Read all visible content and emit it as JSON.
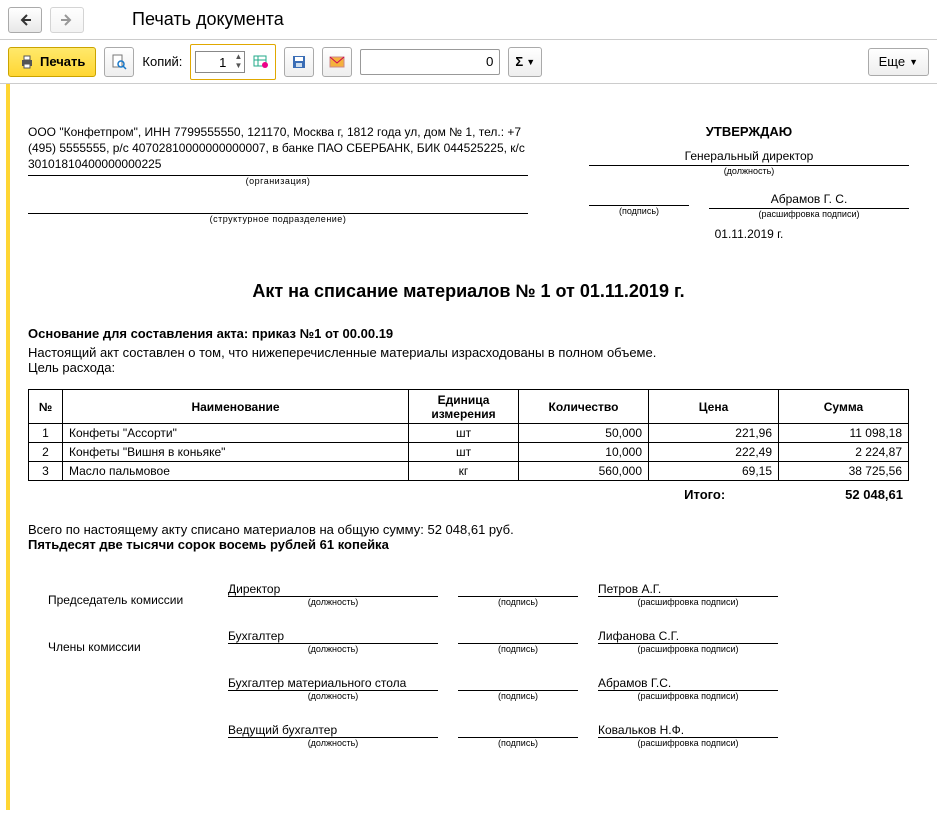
{
  "window": {
    "title": "Печать документа"
  },
  "toolbar": {
    "print_label": "Печать",
    "copies_label": "Копий:",
    "copies_value": "1",
    "num_field_value": "0",
    "sigma_label": "Σ",
    "more_label": "Еще"
  },
  "org": {
    "text": "ООО \"Конфетпром\", ИНН 7799555550, 121170, Москва г, 1812 года ул, дом № 1, тел.: +7 (495) 5555555, р/с 40702810000000000007, в банке ПАО СБЕРБАНК, БИК 044525225, к/с 30101810400000000225",
    "sub_org": "(организация)",
    "sub_div": "(структурное подразделение)"
  },
  "approve": {
    "title": "УТВЕРЖДАЮ",
    "post": "Генеральный директор",
    "post_sub": "(должность)",
    "sign_sub": "(подпись)",
    "name": "Абрамов Г. С.",
    "name_sub": "(расшифровка подписи)",
    "date": "01.11.2019 г."
  },
  "doc": {
    "title": "Акт на списание материалов № 1 от 01.11.2019 г.",
    "basis_label": "Основание для составления акта:",
    "basis_value": "приказ №1 от 00.00.19",
    "description": "Настоящий акт составлен о том, что нижеперечисленные материалы израсходованы в полном объеме.",
    "purpose_label": "Цель расхода:"
  },
  "table": {
    "headers": {
      "num": "№",
      "name": "Наименование",
      "unit": "Единица измерения",
      "qty": "Количество",
      "price": "Цена",
      "sum": "Сумма"
    },
    "rows": [
      {
        "num": "1",
        "name": "Конфеты \"Ассорти\"",
        "unit": "шт",
        "qty": "50,000",
        "price": "221,96",
        "sum": "11 098,18"
      },
      {
        "num": "2",
        "name": "Конфеты \"Вишня в коньяке\"",
        "unit": "шт",
        "qty": "10,000",
        "price": "222,49",
        "sum": "2 224,87"
      },
      {
        "num": "3",
        "name": "Масло пальмовое",
        "unit": "кг",
        "qty": "560,000",
        "price": "69,15",
        "sum": "38 725,56"
      }
    ],
    "total_label": "Итого:",
    "total_value": "52 048,61"
  },
  "summary": {
    "text": "Всего по настоящему акту списано материалов на общую сумму: 52 048,61 руб.",
    "words": "Пятьдесят две тысячи сорок восемь рублей 61 копейка"
  },
  "commission": {
    "chair_label": "Председатель комиссии",
    "members_label": "Члены комиссии",
    "post_sub": "(должность)",
    "sign_sub": "(подпись)",
    "name_sub": "(расшифровка подписи)",
    "rows": [
      {
        "post": "Директор",
        "name": "Петров А.Г."
      },
      {
        "post": "Бухгалтер",
        "name": "Лифанова С.Г."
      },
      {
        "post": "Бухгалтер материального стола",
        "name": "Абрамов Г.С."
      },
      {
        "post": "Ведущий бухгалтер",
        "name": "Ковальков Н.Ф."
      }
    ]
  }
}
